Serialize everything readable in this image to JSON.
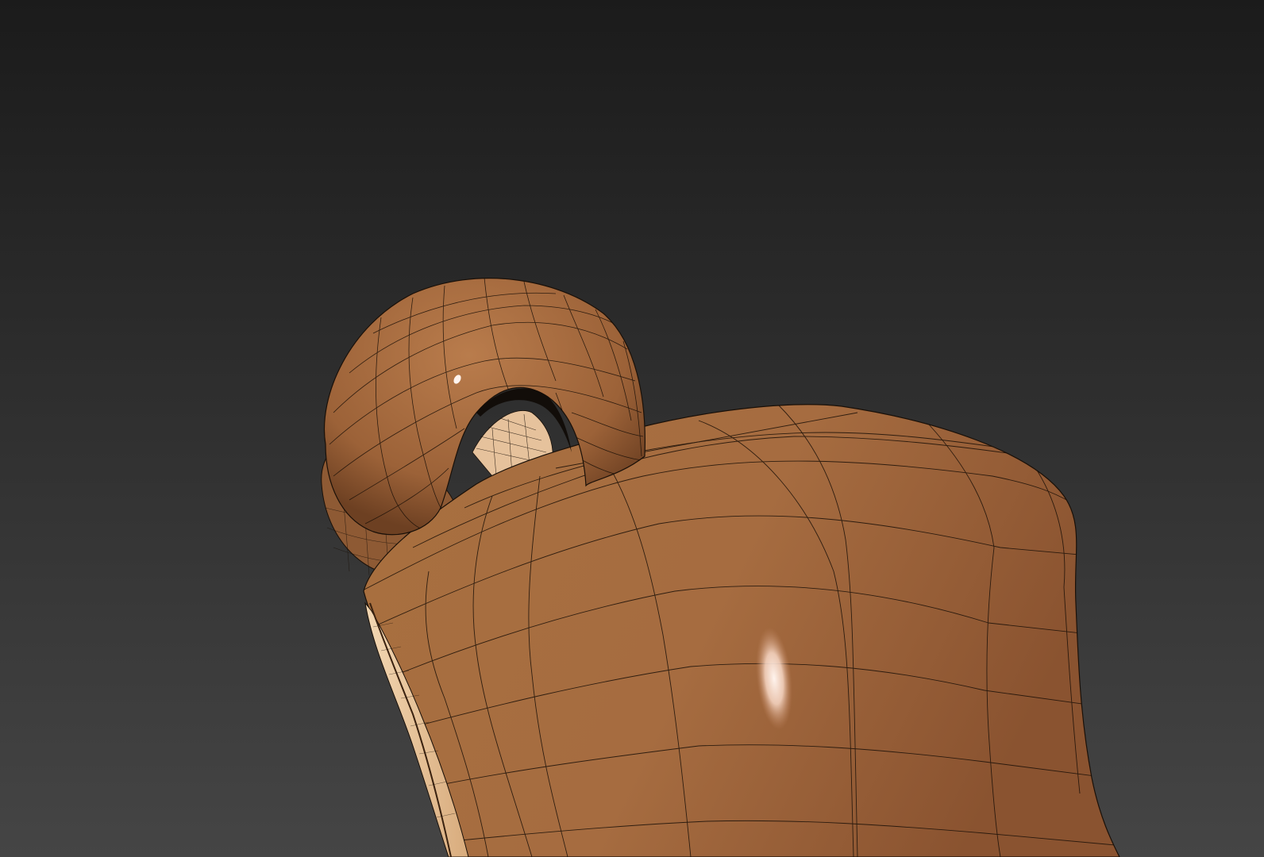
{
  "viewport": {
    "background_top": "#1b1b1b",
    "background_bottom": "#454545"
  },
  "model": {
    "body_color_light": "#b5774a",
    "body_color_mid": "#a36a3f",
    "body_color_dark": "#7a4a27",
    "inner_color": "#e8c49a",
    "wire_color": "#1a1008",
    "highlight_color": "#fff2ea"
  }
}
